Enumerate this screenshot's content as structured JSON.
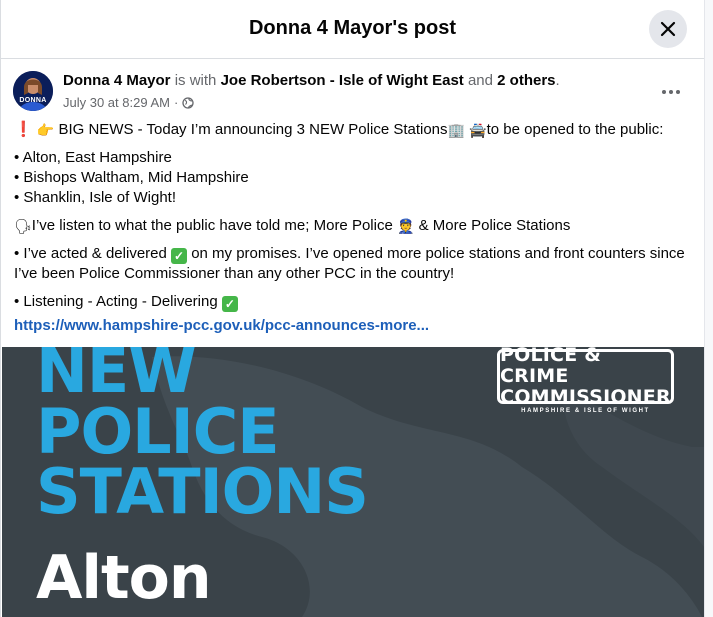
{
  "dialog": {
    "title": "Donna 4 Mayor's post",
    "close_icon": "close-icon"
  },
  "post": {
    "avatar_label": "DONNA",
    "author": "Donna 4 Mayor",
    "with_text": "is with",
    "tagged": "Joe Robertson - Isle of Wight East",
    "and_text": "and",
    "others": "2 others",
    "period": ".",
    "timestamp": "July 30 at 8:29 AM",
    "separator": "·",
    "audience_icon": "globe-icon",
    "menu_icon": "more-options-icon",
    "intro_prefix": "BIG NEWS - Today I’m announcing 3 NEW Police Stations",
    "intro_suffix": "to be opened to the public:",
    "locations": [
      "• Alton, East Hampshire",
      "• Bishops Waltham, Mid Hampshire",
      "• Shanklin, Isle of Wight!"
    ],
    "listen_prefix": "I’ve listen to what the public have told me; More Police",
    "listen_suffix": "& More Police Stations",
    "acted_prefix": "• I’ve acted & delivered",
    "acted_suffix": "on my promises. I’ve opened more police stations and front counters since I’ve been Police Commissioner than any other PCC in the country!",
    "closing": "• Listening - Acting - Delivering",
    "link": "https://www.hampshire-pcc.gov.uk/pcc-announces-more..."
  },
  "banner": {
    "line1": "NEW",
    "line2": "POLICE",
    "line3": "STATIONS",
    "town": "Alton",
    "logo_line1": "POLICE & CRIME",
    "logo_line2": "COMMISSIONER",
    "logo_sub": "HAMPSHIRE & ISLE OF WIGHT"
  },
  "colors": {
    "accent_link": "#1d5fb9",
    "banner_bg": "#3a4349",
    "banner_text": "#29a8e0",
    "check_green": "#45b649"
  }
}
